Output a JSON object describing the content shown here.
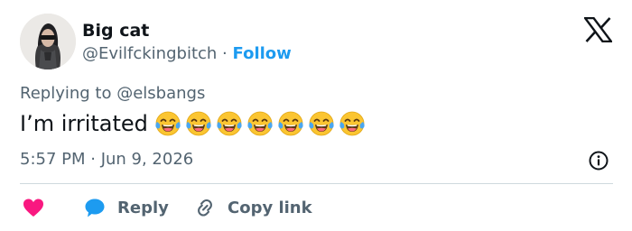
{
  "author": {
    "display_name": "Big cat",
    "handle": "@Evilfckingbitch",
    "separator": "·",
    "follow_label": "Follow"
  },
  "reply_context": {
    "prefix": "Replying to",
    "mention": "@elsbangs"
  },
  "tweet": {
    "text": "I’m irritated",
    "emojis": [
      "face-with-tears-of-joy",
      "face-with-tears-of-joy",
      "face-with-tears-of-joy",
      "face-with-tears-of-joy",
      "face-with-tears-of-joy",
      "face-with-tears-of-joy",
      "face-with-tears-of-joy"
    ]
  },
  "meta": {
    "timestamp": "5:57 PM · Jun 9, 2026"
  },
  "actions": {
    "like_icon": "heart-icon",
    "reply_label": "Reply",
    "copy_link_label": "Copy link"
  },
  "colors": {
    "accent": "#1d9bf0",
    "like": "#f91880",
    "muted_text": "#536471",
    "text": "#0f1419"
  }
}
